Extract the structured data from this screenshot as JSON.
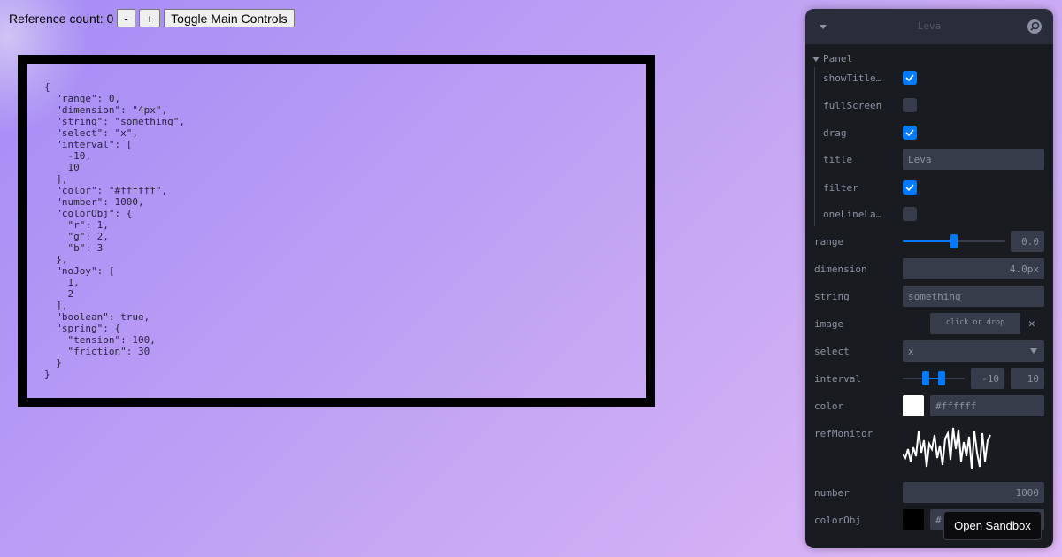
{
  "topbar": {
    "reference_count_label": "Reference count: 0",
    "minus_label": "-",
    "plus_label": "+",
    "toggle_label": "Toggle Main Controls"
  },
  "code": {
    "json_text": "{\n  \"range\": 0,\n  \"dimension\": \"4px\",\n  \"string\": \"something\",\n  \"select\": \"x\",\n  \"interval\": [\n    -10,\n    10\n  ],\n  \"color\": \"#ffffff\",\n  \"number\": 1000,\n  \"colorObj\": {\n    \"r\": 1,\n    \"g\": 2,\n    \"b\": 3\n  },\n  \"noJoy\": [\n    1,\n    2\n  ],\n  \"boolean\": true,\n  \"spring\": {\n    \"tension\": 100,\n    \"friction\": 30\n  }\n}"
  },
  "panel": {
    "title": "Leva",
    "folder_label": "Panel",
    "rows": {
      "showTitle": {
        "label": "showTitle…",
        "checked": true
      },
      "fullScreen": {
        "label": "fullScreen",
        "checked": false
      },
      "drag": {
        "label": "drag",
        "checked": true
      },
      "title": {
        "label": "title",
        "value": "Leva"
      },
      "filter": {
        "label": "filter",
        "checked": true
      },
      "oneLineLabels": {
        "label": "oneLineLa…",
        "checked": false
      },
      "range": {
        "label": "range",
        "value": "0.0",
        "level": 0.5
      },
      "dimension": {
        "label": "dimension",
        "value": "4.0px"
      },
      "string": {
        "label": "string",
        "value": "something"
      },
      "image": {
        "label": "image",
        "button": "click or drop",
        "clear": "✕"
      },
      "select": {
        "label": "select",
        "value": "x"
      },
      "interval": {
        "label": "interval",
        "min_value": "-10",
        "max_value": "10"
      },
      "color": {
        "label": "color",
        "value": "#ffffff",
        "swatch": "#ffffff"
      },
      "refMonitor": {
        "label": "refMonitor"
      },
      "number": {
        "label": "number",
        "value": "1000"
      },
      "colorObj": {
        "label": "colorObj",
        "value": "#",
        "swatch": "#000000"
      }
    }
  },
  "sandbox_button": "Open Sandbox",
  "colors": {
    "accent": "#007bff",
    "panel_bg": "#181c20",
    "header_bg": "#292d39",
    "field_bg": "#373c4b"
  }
}
